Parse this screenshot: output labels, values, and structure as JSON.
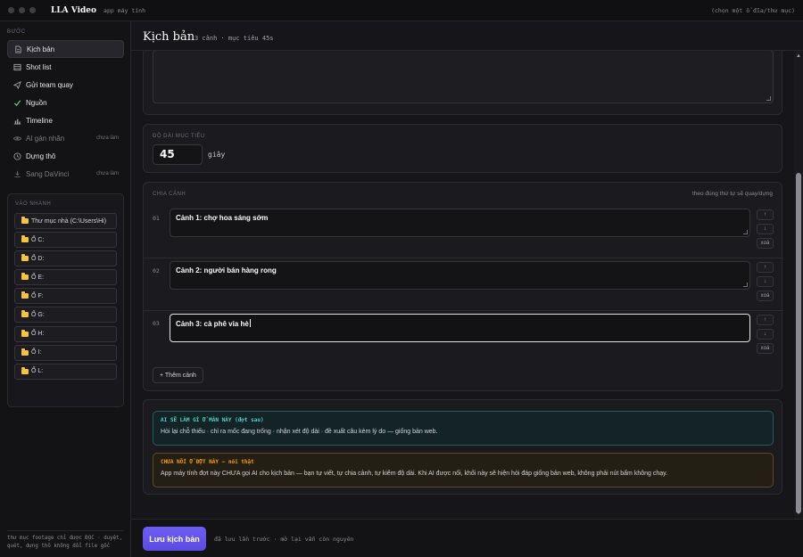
{
  "window": {
    "app_title": "LLA Video",
    "app_subtitle": "app máy tính",
    "drive_hint": "(chọn một ổ đĩa/thư mục)"
  },
  "sidebar": {
    "steps_label": "BƯỚC",
    "steps": [
      {
        "label": "Kịch bản",
        "icon": "document-icon",
        "active": true
      },
      {
        "label": "Shot list",
        "icon": "list-icon"
      },
      {
        "label": "Gửi team quay",
        "icon": "send-icon"
      },
      {
        "label": "Nguồn",
        "icon": "check-icon"
      },
      {
        "label": "Timeline",
        "icon": "bar-chart-icon"
      },
      {
        "label": "AI gán nhãn",
        "icon": "eye-icon",
        "badge": "chưa làm",
        "muted": true
      },
      {
        "label": "Dựng thô",
        "icon": "clock-icon"
      },
      {
        "label": "Sang DaVinci",
        "icon": "download-icon",
        "badge": "chưa làm",
        "muted": true
      }
    ],
    "quick_label": "VÀO NHANH",
    "quick_items": [
      "Thư mục nhà (C:\\Users\\Hi)",
      "Ổ C:",
      "Ổ D:",
      "Ổ E:",
      "Ổ F:",
      "Ổ G:",
      "Ổ H:",
      "Ổ I:",
      "Ổ L:"
    ],
    "footnote": "thư mục footage chỉ được ĐỌC · duyệt, quét, dựng thô không đổi file gốc"
  },
  "header": {
    "title": "Kịch bản",
    "meta": "3 cảnh · mục tiêu 45s"
  },
  "duration": {
    "label": "ĐỘ DÀI MỤC TIÊU",
    "value": "45",
    "unit": "giây"
  },
  "scenes": {
    "label": "CHIA CẢNH",
    "order_note": "theo đúng thứ tự sẽ quay/dựng",
    "items": [
      {
        "num": "01",
        "text": "Cảnh 1: chợ hoa sáng sớm"
      },
      {
        "num": "02",
        "text": "Cảnh 2: người bán hàng rong"
      },
      {
        "num": "03",
        "text": "Cảnh 3: cà phê vỉa hè",
        "focused": true
      }
    ],
    "up_label": "↑",
    "down_label": "↓",
    "delete_label": "xoá",
    "add_label": "+ Thêm cảnh"
  },
  "notes": {
    "ai_title": "AI SẼ LÀM GÌ Ở MÀN NÀY (đợt sau)",
    "ai_text": "Hỏi lại chỗ thiếu · chỉ ra mốc đang trống · nhận xét độ dài · đề xuất câu kèm lý do — giống bản web.",
    "warn_title": "CHƯA NỐI Ở ĐỢT NÀY — nói thật",
    "warn_text": "App máy tính đợt này CHƯA gọi AI cho kịch bản — bạn tự viết, tự chia cảnh, tự kiểm độ dài. Khi AI được nối, khối này sẽ hiện hỏi đáp giống bản web, không phải nút bấm không chạy."
  },
  "footer": {
    "save_label": "Lưu kịch bản",
    "save_note": "đã lưu lần trước · mở lại vẫn còn nguyên"
  },
  "colors": {
    "accent": "#6d5ef5",
    "success": "#4ade80",
    "ai_note": "#4fd1c5",
    "warning": "#f59e0b"
  }
}
